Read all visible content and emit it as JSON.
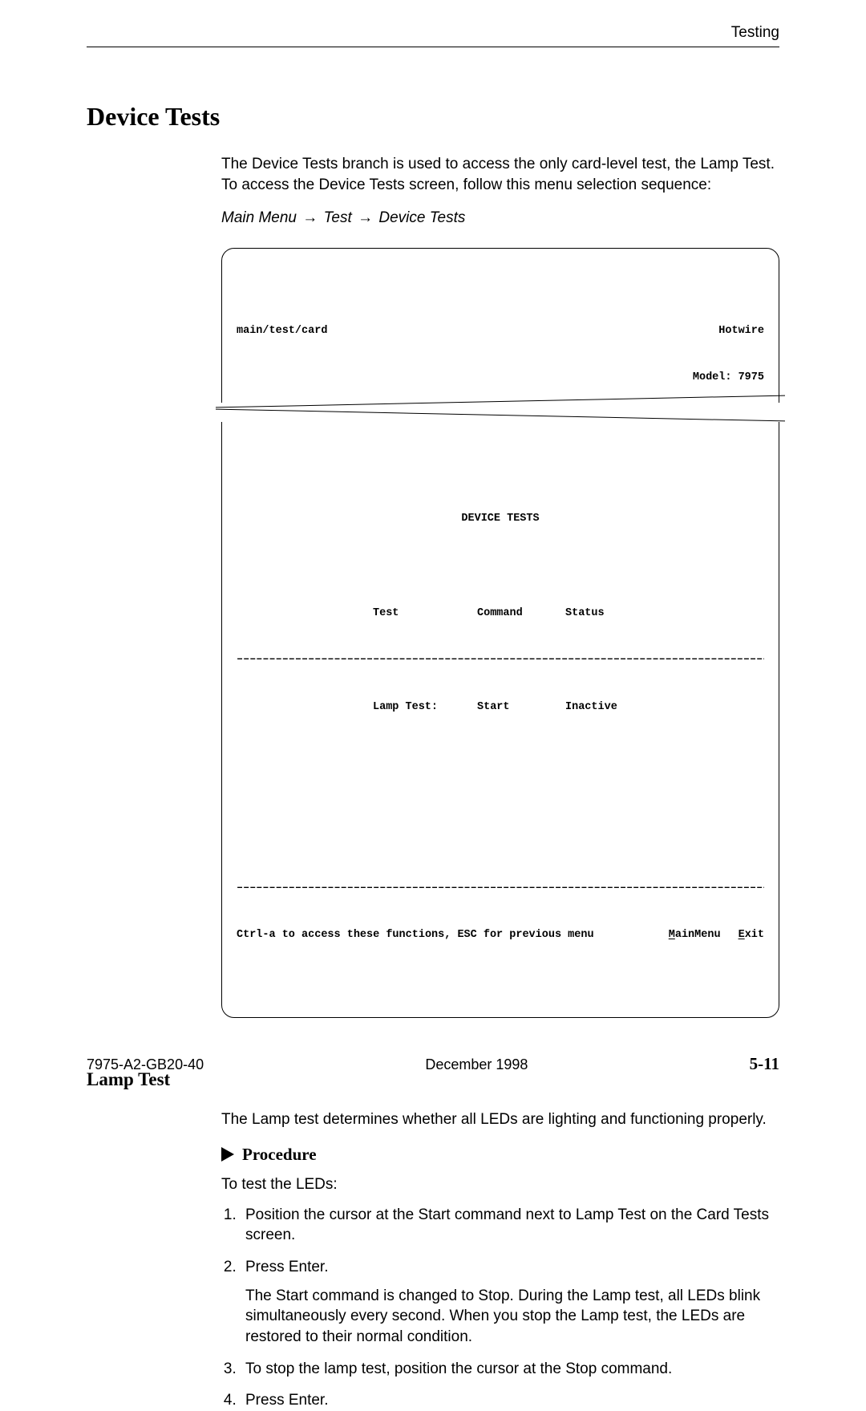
{
  "header": {
    "section_label": "Testing"
  },
  "headings": {
    "device_tests": "Device Tests",
    "lamp_test": "Lamp Test",
    "procedure": "Procedure"
  },
  "intro": {
    "p1": "The Device Tests branch is used to access the only card-level test, the Lamp Test. To access the Device Tests screen, follow this menu selection sequence:",
    "crumb_main": "Main Menu",
    "crumb_test": "Test",
    "crumb_device": "Device Tests",
    "arrow": "→"
  },
  "terminal": {
    "path": "main/test/card",
    "brand": "Hotwire",
    "model_label": "Model: 7975",
    "title": "DEVICE TESTS",
    "col_test": "Test",
    "col_command": "Command",
    "col_status": "Status",
    "row_test": "Lamp Test:",
    "row_command": "Start",
    "row_status": "Inactive",
    "hint": "Ctrl-a to access these functions, ESC for previous menu",
    "menu_main_u": "M",
    "menu_main_rest": "ainMenu",
    "menu_exit_u": "E",
    "menu_exit_rest": "xit",
    "dashes": "––––––––––––––––––––––––––––––––––––––––––––––––––––––––––––––––––––––––––––––––––"
  },
  "lamp": {
    "desc": "The Lamp test determines whether all LEDs are lighting and functioning properly.",
    "instr": "To test the LEDs:",
    "steps": {
      "s1": "Position the cursor at the Start command next to Lamp Test on the Card Tests screen.",
      "s2": "Press Enter.",
      "s2b": "The Start command is changed to Stop. During the Lamp test, all LEDs blink simultaneously every second. When you stop the Lamp test, the LEDs are restored to their normal condition.",
      "s3": "To stop the lamp test, position the cursor at the Stop command.",
      "s4": "Press Enter."
    }
  },
  "footer": {
    "left": "7975-A2-GB20-40",
    "center": "December 1998",
    "right": "5-11"
  }
}
